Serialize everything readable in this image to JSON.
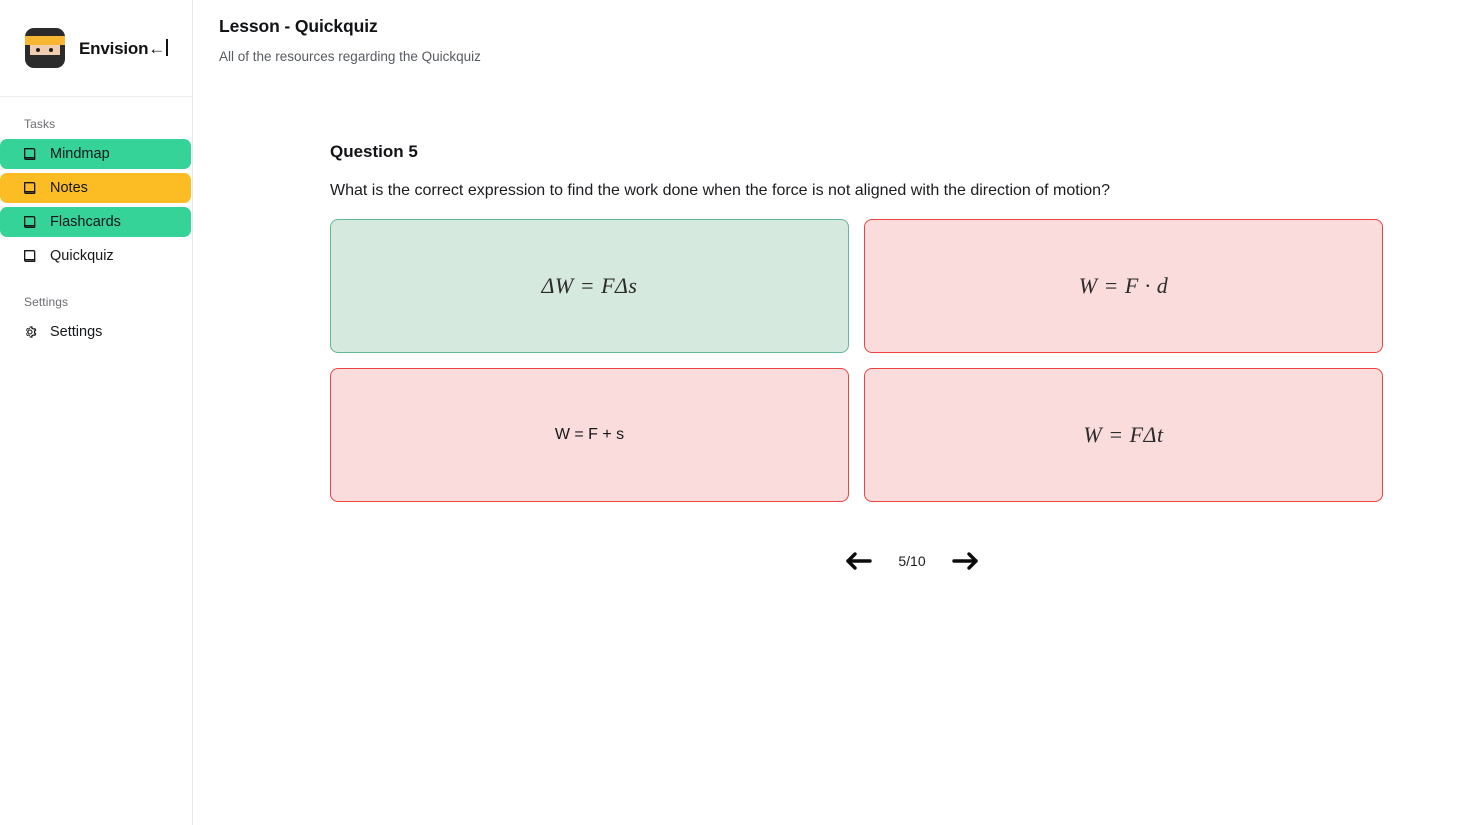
{
  "sidebar": {
    "brand": {
      "title": "Envision",
      "arrow_glyph": "←",
      "logo_icon": "ninja-logo-icon"
    },
    "sections": [
      {
        "label": "Tasks"
      },
      {
        "label": "Settings"
      }
    ],
    "task_items": [
      {
        "label": "Mindmap",
        "icon": "book-icon",
        "state": "green"
      },
      {
        "label": "Notes",
        "icon": "book-icon",
        "state": "yellow"
      },
      {
        "label": "Flashcards",
        "icon": "book-icon",
        "state": "green"
      },
      {
        "label": "Quickquiz",
        "icon": "book-icon",
        "state": "plain"
      }
    ],
    "settings_items": [
      {
        "label": "Settings",
        "icon": "gear-icon",
        "state": "plain"
      }
    ]
  },
  "header": {
    "title": "Lesson - Quickquiz",
    "subtitle": "All of the resources regarding the Quickquiz"
  },
  "quiz": {
    "question_number_label": "Question 5",
    "question_text": "What is the correct expression to find the work done when the force is not aligned with the direction of motion?",
    "options": [
      {
        "text": "ΔW = FΔs",
        "state": "correct",
        "render": "math"
      },
      {
        "text": "W = F · d",
        "state": "wrong",
        "render": "math"
      },
      {
        "text": "W = F + s",
        "state": "wrong",
        "render": "plain"
      },
      {
        "text": "W = FΔt",
        "state": "wrong",
        "render": "math"
      }
    ],
    "pager": {
      "prev_label": "←",
      "next_label": "→",
      "counter": "5/10"
    }
  },
  "colors": {
    "green_pill": "#36d399",
    "yellow_pill": "#fbbd23",
    "correct_fill": "#d6e9df",
    "correct_border": "#63b894",
    "wrong_fill": "#fbdcdc",
    "wrong_border": "#ef4343"
  }
}
